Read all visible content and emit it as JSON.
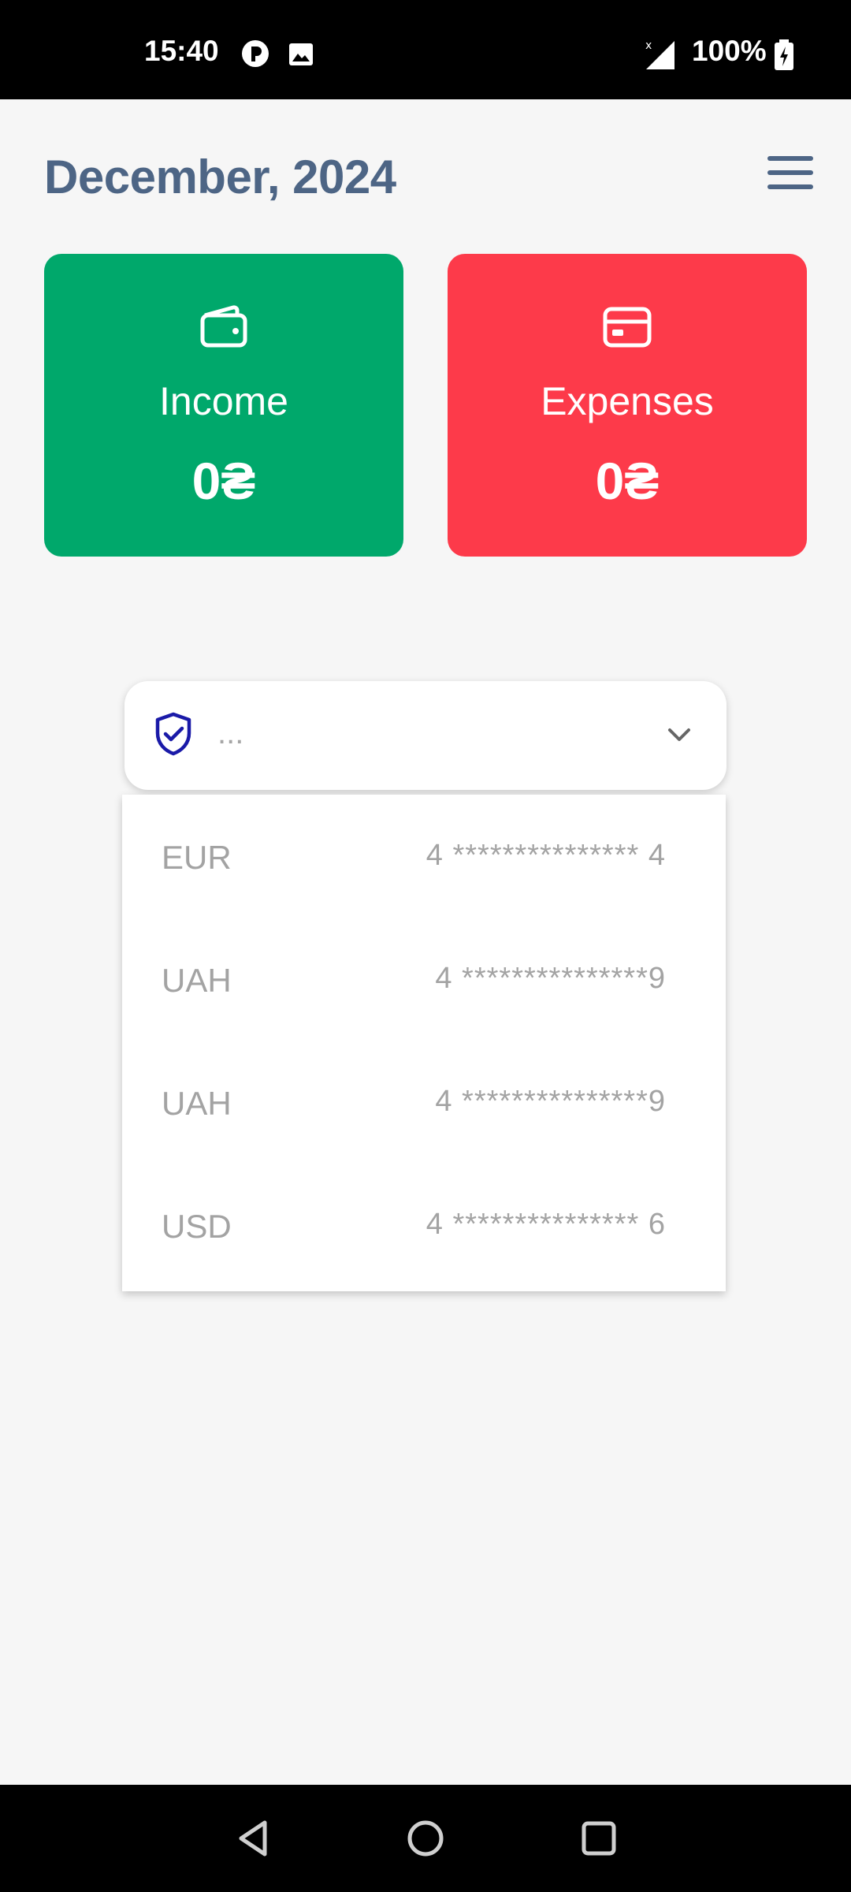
{
  "status_bar": {
    "time": "15:40",
    "battery": "100%",
    "icons": [
      "app-notification-icon",
      "image-notification-icon",
      "signal-icon",
      "battery-charging-icon"
    ]
  },
  "header": {
    "title": "December, 2024",
    "menu_icon": "hamburger-menu-icon"
  },
  "summary_cards": {
    "income": {
      "label": "Income",
      "amount": "0₴",
      "icon": "wallet-icon",
      "color": "#00a86b"
    },
    "expenses": {
      "label": "Expenses",
      "amount": "0₴",
      "icon": "credit-card-icon",
      "color": "#fd3a4a"
    }
  },
  "account_select": {
    "value": "...",
    "icon": "shield-check-icon",
    "accent": "#1a1aa8",
    "chevron": "chevron-down-icon"
  },
  "accounts": [
    {
      "currency": "EUR",
      "card": "4 *************** 4"
    },
    {
      "currency": "UAH",
      "card": "4 ***************9"
    },
    {
      "currency": "UAH",
      "card": "4 ***************9"
    },
    {
      "currency": "USD",
      "card": "4 *************** 6"
    }
  ],
  "nav_bar": {
    "buttons": [
      "back-icon",
      "home-icon",
      "recents-icon"
    ]
  }
}
